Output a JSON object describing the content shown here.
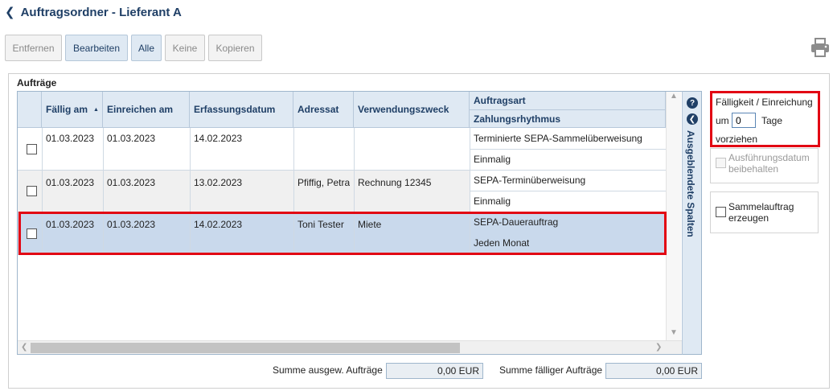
{
  "header": {
    "title": "Auftragsordner - Lieferant A"
  },
  "toolbar": {
    "remove_label": "Entfernen",
    "edit_label": "Bearbeiten",
    "all_label": "Alle",
    "none_label": "Keine",
    "copy_label": "Kopieren",
    "print_icon": "printer-icon"
  },
  "orders": {
    "legend": "Aufträge",
    "columns": {
      "due": "Fällig am",
      "submit": "Einreichen am",
      "created": "Erfassungsdatum",
      "addressee": "Adressat",
      "purpose": "Verwendungszweck",
      "type": "Auftragsart",
      "rhythm": "Zahlungsrhythmus"
    },
    "hidden_columns_label": "Ausgeblendete Spalten",
    "rows": [
      {
        "due": "01.03.2023",
        "submit": "01.03.2023",
        "created": "14.02.2023",
        "addressee": "",
        "purpose": "",
        "type": "Terminierte SEPA-Sammelüberweisung",
        "rhythm": "Einmalig"
      },
      {
        "due": "01.03.2023",
        "submit": "01.03.2023",
        "created": "13.02.2023",
        "addressee": "Pfiffig, Petra",
        "purpose": "Rechnung 12345",
        "type": "SEPA-Terminüberweisung",
        "rhythm": "Einmalig"
      },
      {
        "due": "01.03.2023",
        "submit": "01.03.2023",
        "created": "14.02.2023",
        "addressee": "Toni Tester",
        "purpose": "Miete",
        "type": "SEPA-Dauerauftrag",
        "rhythm": "Jeden Monat"
      }
    ]
  },
  "sums": {
    "selected_label": "Summe ausgew. Aufträge",
    "selected_value": "0,00 EUR",
    "due_label": "Summe fälliger Aufträge",
    "due_value": "0,00 EUR"
  },
  "options": {
    "due_line1": "Fälligkeit / Einreichung",
    "due_prefix": "um",
    "days_value": "0",
    "due_suffix": "Tage",
    "due_line3": "vorziehen",
    "keep_date_label_1": "Ausführungsdatum",
    "keep_date_label_2": "beibehalten",
    "batch_label_1": "Sammelauftrag",
    "batch_label_2": "erzeugen"
  }
}
